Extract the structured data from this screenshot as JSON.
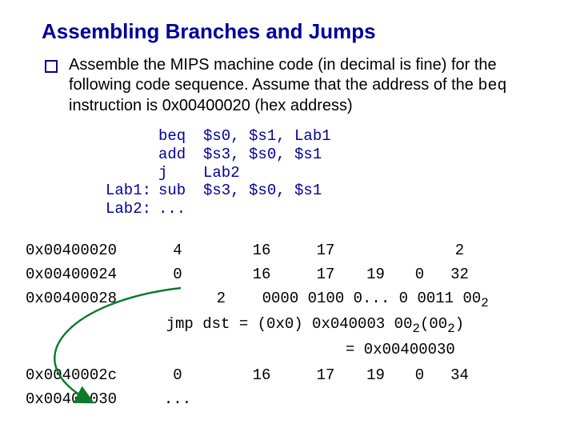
{
  "title": "Assembling Branches and Jumps",
  "question": {
    "before_mono": "Assemble the MIPS machine code (in decimal is fine) for the following code sequence.  Assume that the address of the ",
    "mono": "beq",
    "after_mono": " instruction is 0x00400020 (hex address)"
  },
  "code": {
    "lines": [
      {
        "label": "",
        "op": "beq",
        "args": "$s0, $s1, Lab1"
      },
      {
        "label": "",
        "op": "add",
        "args": "$s3, $s0, $s1"
      },
      {
        "label": "",
        "op": "j",
        "args": "Lab2"
      },
      {
        "label": "Lab1:",
        "op": "sub",
        "args": "$s3, $s0, $s1"
      },
      {
        "label": "Lab2:",
        "op": "...",
        "args": ""
      }
    ]
  },
  "rows": [
    {
      "addr": "0x00400020",
      "kind": "fields",
      "cells": [
        "4",
        "16",
        "17",
        "",
        "",
        "2"
      ]
    },
    {
      "addr": "0x00400024",
      "kind": "fields",
      "cells": [
        "0",
        "16",
        "17",
        "19",
        "0",
        "32"
      ]
    },
    {
      "addr": "0x00400028",
      "kind": "jump1",
      "opc": "2",
      "bits": "0000 0100 0... 0 0011 00",
      "sub": "2"
    },
    {
      "addr": "",
      "kind": "jump2",
      "lhs": "jmp dst =",
      "mid": "(0x0) 0x040003 00",
      "subA": "2",
      "paren": "(00",
      "subB": "2",
      "close": ")"
    },
    {
      "addr": "",
      "kind": "jump3",
      "text": "= 0x00400030"
    },
    {
      "addr": "0x0040002c",
      "kind": "fields",
      "cells": [
        "0",
        "16",
        "17",
        "19",
        "0",
        "34"
      ]
    },
    {
      "addr": "0x00400030",
      "kind": "dots",
      "cell": "..."
    }
  ],
  "arrow_color": "#0c7a2a"
}
